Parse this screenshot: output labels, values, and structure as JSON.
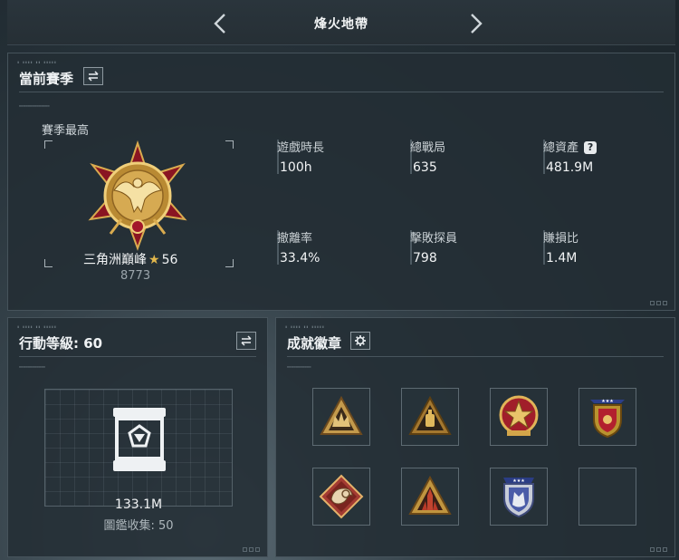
{
  "header": {
    "title": "烽火地帶"
  },
  "season": {
    "title": "當前賽季",
    "best_label": "賽季最高",
    "rank_name": "三角洲巔峰",
    "rank_level": "56",
    "rank_score": "8773",
    "stats": [
      {
        "label": "遊戲時長",
        "value": "100h"
      },
      {
        "label": "總戰局",
        "value": "635"
      },
      {
        "label": "總資產",
        "value": "481.9M",
        "help": "?"
      },
      {
        "label": "撤離率",
        "value": "33.4%"
      },
      {
        "label": "擊敗探員",
        "value": "798"
      },
      {
        "label": "賺損比",
        "value": "1.4M"
      }
    ]
  },
  "level": {
    "title": "行動等級: 60",
    "value": "133.1M",
    "collection": "圖鑑收集: 50"
  },
  "achievements": {
    "title": "成就徽章",
    "badges": [
      {
        "icon": "crown-triangle-badge"
      },
      {
        "icon": "bottle-triangle-badge"
      },
      {
        "icon": "star-shield-badge"
      },
      {
        "icon": "crest-shield-badge"
      },
      {
        "icon": "ram-diamond-badge"
      },
      {
        "icon": "tower-triangle-badge"
      },
      {
        "icon": "wolf-shield-badge"
      },
      {
        "icon": "empty-slot"
      }
    ]
  },
  "colors": {
    "accent_gold": "#e2b74c",
    "medal_red": "#a3172b",
    "panel": "#232d34"
  }
}
